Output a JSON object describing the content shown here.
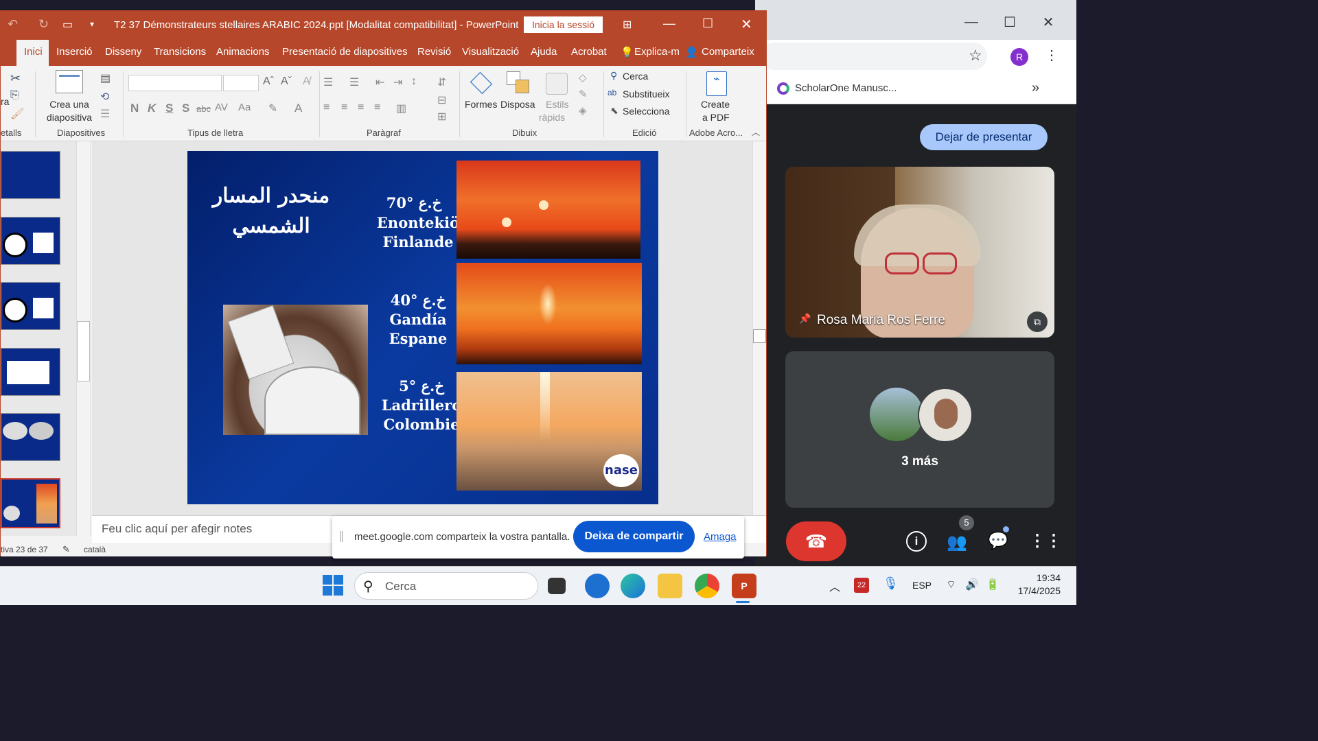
{
  "ppt": {
    "title": "T2 37 Démonstrateurs stellaires ARABIC 2024.ppt [Modalitat compatibilitat]  -  PowerPoint",
    "signin": "Inicia la sessió",
    "tabs": [
      "Inici",
      "Inserció",
      "Disseny",
      "Transicions",
      "Animacions",
      "Presentació de diapositives",
      "Revisió",
      "Visualització",
      "Ajuda",
      "Acrobat",
      "Explica-m",
      "Comparteix"
    ],
    "ribbon": {
      "new_slide": [
        "Crea una",
        "diapositiva"
      ],
      "groups": [
        "etalls",
        "Diapositives",
        "Tipus de lletra",
        "Paràgraf",
        "Dibuix",
        "Edició",
        "Adobe Acro..."
      ],
      "shapes": "Formes",
      "arrange": "Disposa",
      "quick_styles": [
        "Estils",
        "ràpids"
      ],
      "find": "Cerca",
      "replace": "Substitueix",
      "select": "Selecciona",
      "create_pdf": [
        "Create",
        "a PDF"
      ],
      "left_cut": "ra",
      "font_btns": [
        "N",
        "K",
        "S",
        "S",
        "abc",
        "AV",
        "Aa",
        "A"
      ]
    },
    "slide": {
      "arabic_title": [
        "منحدر المسار",
        "الشمسي"
      ],
      "rows": [
        {
          "lat": "خ.ع °70",
          "place": "Enontekiö",
          "country": "Finlande"
        },
        {
          "lat": "خ.ع °40",
          "place": "Gandía",
          "country": "Espane"
        },
        {
          "lat": "خ.ع °5",
          "place": "Ladrillero",
          "country": "Colombie"
        }
      ],
      "logo": "nase"
    },
    "notes_placeholder": "Feu clic aquí per afegir notes",
    "status_slide": "tiva 23 de 37",
    "status_lang": "català"
  },
  "share_banner": {
    "text": "meet.google.com comparteix la vostra pantalla.",
    "stop": "Deixa de compartir",
    "hide": "Amaga"
  },
  "chrome": {
    "bookmark": "ScholarOne Manusc...",
    "avatar": "R"
  },
  "meet": {
    "stop_presenting": "Dejar de presentar",
    "participant": "Rosa Maria Ros Ferre",
    "more": "3 más",
    "people_count": "5"
  },
  "taskbar": {
    "search": "Cerca",
    "lang": "ESP",
    "time": "19:34",
    "date": "17/4/2025",
    "cal_badge": "22"
  },
  "colors": {
    "ppt_accent": "#b7472a",
    "meet_blue": "#0b57d0",
    "slide_bg": "#0a3aa0",
    "hangup": "#ea4335"
  }
}
